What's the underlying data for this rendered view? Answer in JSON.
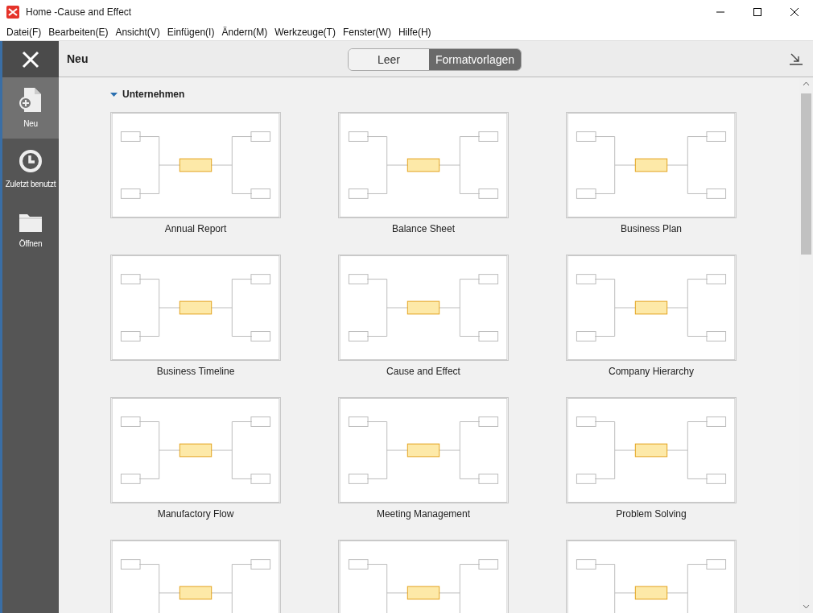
{
  "window": {
    "title": "Home -Cause and Effect"
  },
  "menu": [
    "Datei(F)",
    "Bearbeiten(E)",
    "Ansicht(V)",
    "Einfügen(I)",
    "Ändern(M)",
    "Werkzeuge(T)",
    "Fenster(W)",
    "Hilfe(H)"
  ],
  "sidebar": {
    "items": [
      {
        "label": "Neu",
        "selected": true
      },
      {
        "label": "Zuletzt benutzt",
        "selected": false
      },
      {
        "label": "Öffnen",
        "selected": false
      }
    ]
  },
  "header": {
    "title": "Neu",
    "segments": [
      {
        "label": "Leer",
        "selected": false
      },
      {
        "label": "Formatvorlagen",
        "selected": true
      }
    ]
  },
  "section": {
    "title": "Unternehmen",
    "expanded": true
  },
  "templates": [
    {
      "kind": "full",
      "label": "Annual Report"
    },
    {
      "kind": "full",
      "label": "Balance Sheet"
    },
    {
      "kind": "full",
      "label": "Business Plan"
    },
    {
      "kind": "full",
      "label": "Business Timeline"
    },
    {
      "kind": "full",
      "label": "Cause and Effect"
    },
    {
      "kind": "full",
      "label": "Company Hierarchy"
    },
    {
      "kind": "full",
      "label": "Manufactory Flow"
    },
    {
      "kind": "full",
      "label": "Meeting Management"
    },
    {
      "kind": "full",
      "label": "Problem Solving"
    },
    {
      "kind": "partial"
    },
    {
      "kind": "partial"
    },
    {
      "kind": "partial"
    }
  ]
}
